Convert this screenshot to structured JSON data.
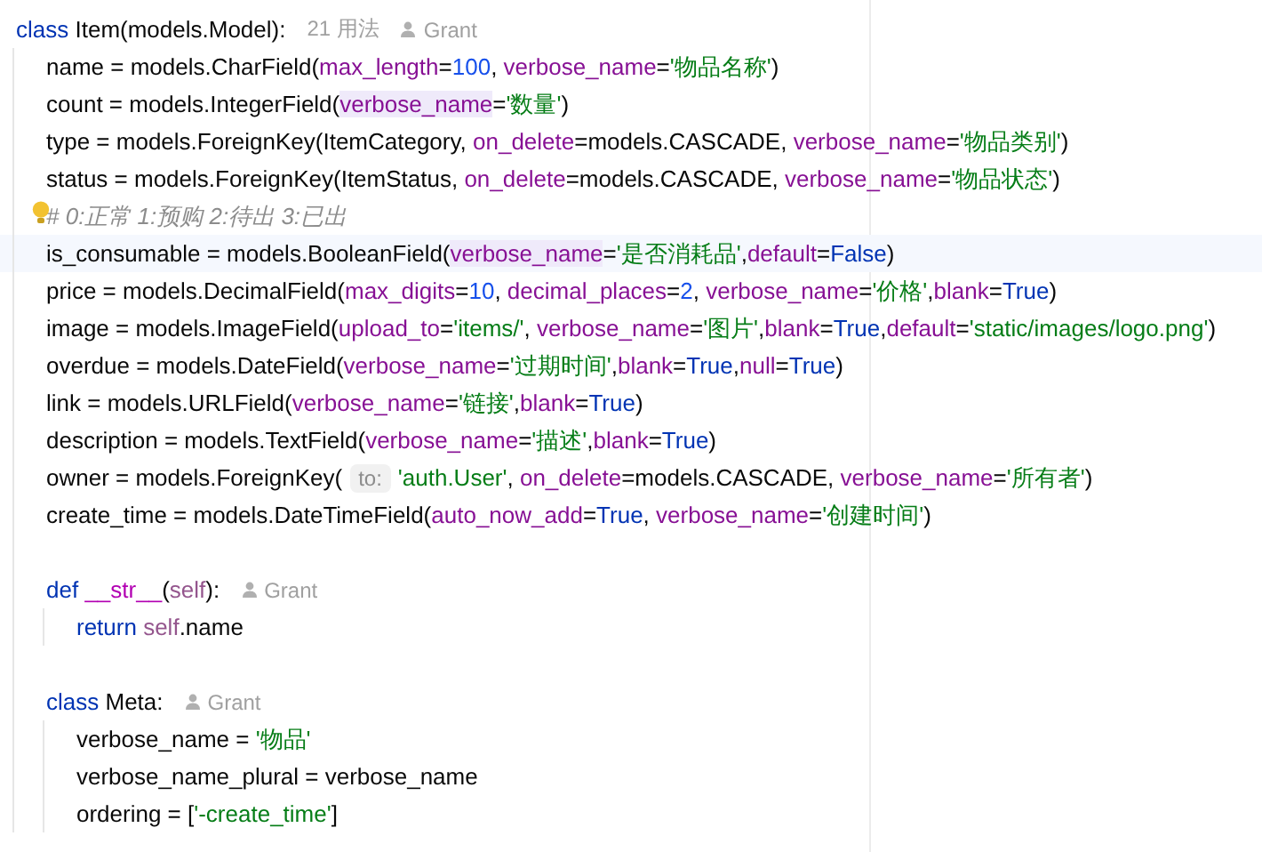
{
  "lines": [
    {
      "kind": "code",
      "tokens": [
        {
          "kind": "kw",
          "t": "class"
        },
        {
          "kind": "plain",
          "t": " Item(models.Model):"
        },
        {
          "kind": "usages",
          "t": "21 用法"
        },
        {
          "kind": "author",
          "t": "Grant"
        }
      ]
    },
    {
      "kind": "code",
      "tokens": [
        {
          "kind": "plain",
          "t": "    name = models.CharField("
        },
        {
          "kind": "param",
          "t": "max_length"
        },
        {
          "kind": "plain",
          "t": "="
        },
        {
          "kind": "num",
          "t": "100"
        },
        {
          "kind": "plain",
          "t": ", "
        },
        {
          "kind": "param",
          "t": "verbose_name"
        },
        {
          "kind": "plain",
          "t": "="
        },
        {
          "kind": "str",
          "t": "'物品名称'"
        },
        {
          "kind": "plain",
          "t": ")"
        }
      ]
    },
    {
      "kind": "code",
      "tokens": [
        {
          "kind": "plain",
          "t": "    count = models.IntegerField("
        },
        {
          "kind": "param-hl",
          "t": "verbose_name"
        },
        {
          "kind": "plain",
          "t": "="
        },
        {
          "kind": "str",
          "t": "'数量'"
        },
        {
          "kind": "plain",
          "t": ")"
        }
      ]
    },
    {
      "kind": "code",
      "tokens": [
        {
          "kind": "plain",
          "t": "    type = models.ForeignKey(ItemCategory, "
        },
        {
          "kind": "param",
          "t": "on_delete"
        },
        {
          "kind": "plain",
          "t": "=models.CASCADE, "
        },
        {
          "kind": "param",
          "t": "verbose_name"
        },
        {
          "kind": "plain",
          "t": "="
        },
        {
          "kind": "str",
          "t": "'物品类别'"
        },
        {
          "kind": "plain",
          "t": ")"
        }
      ]
    },
    {
      "kind": "code",
      "tokens": [
        {
          "kind": "plain",
          "t": "    status = models.ForeignKey(ItemStatus, "
        },
        {
          "kind": "param",
          "t": "on_delete"
        },
        {
          "kind": "plain",
          "t": "=models.CASCADE, "
        },
        {
          "kind": "param",
          "t": "verbose_name"
        },
        {
          "kind": "plain",
          "t": "="
        },
        {
          "kind": "str",
          "t": "'物品状态'"
        },
        {
          "kind": "plain",
          "t": ")"
        }
      ]
    },
    {
      "kind": "code",
      "bulb": true,
      "tokens": [
        {
          "kind": "comment",
          "t": "    # 0:正常 1:预购 2:待出 3:已出"
        }
      ]
    },
    {
      "kind": "code",
      "current": true,
      "tokens": [
        {
          "kind": "plain",
          "t": "    is_consumable = models.BooleanField("
        },
        {
          "kind": "param-hl",
          "t": "verbose_name"
        },
        {
          "kind": "plain",
          "t": "="
        },
        {
          "kind": "str",
          "t": "'是否消耗品'"
        },
        {
          "kind": "plain",
          "t": ","
        },
        {
          "kind": "param",
          "t": "default"
        },
        {
          "kind": "plain",
          "t": "="
        },
        {
          "kind": "const",
          "t": "False"
        },
        {
          "kind": "plain",
          "t": ")"
        }
      ]
    },
    {
      "kind": "code",
      "tokens": [
        {
          "kind": "plain",
          "t": "    price = models.DecimalField("
        },
        {
          "kind": "param",
          "t": "max_digits"
        },
        {
          "kind": "plain",
          "t": "="
        },
        {
          "kind": "num",
          "t": "10"
        },
        {
          "kind": "plain",
          "t": ", "
        },
        {
          "kind": "param",
          "t": "decimal_places"
        },
        {
          "kind": "plain",
          "t": "="
        },
        {
          "kind": "num",
          "t": "2"
        },
        {
          "kind": "plain",
          "t": ", "
        },
        {
          "kind": "param",
          "t": "verbose_name"
        },
        {
          "kind": "plain",
          "t": "="
        },
        {
          "kind": "str",
          "t": "'价格'"
        },
        {
          "kind": "plain",
          "t": ","
        },
        {
          "kind": "param",
          "t": "blank"
        },
        {
          "kind": "plain",
          "t": "="
        },
        {
          "kind": "const",
          "t": "True"
        },
        {
          "kind": "plain",
          "t": ")"
        }
      ]
    },
    {
      "kind": "code",
      "tokens": [
        {
          "kind": "plain",
          "t": "    image = models.ImageField("
        },
        {
          "kind": "param",
          "t": "upload_to"
        },
        {
          "kind": "plain",
          "t": "="
        },
        {
          "kind": "str",
          "t": "'items/'"
        },
        {
          "kind": "plain",
          "t": ", "
        },
        {
          "kind": "param",
          "t": "verbose_name"
        },
        {
          "kind": "plain",
          "t": "="
        },
        {
          "kind": "str",
          "t": "'图片'"
        },
        {
          "kind": "plain",
          "t": ","
        },
        {
          "kind": "param",
          "t": "blank"
        },
        {
          "kind": "plain",
          "t": "="
        },
        {
          "kind": "const",
          "t": "True"
        },
        {
          "kind": "plain",
          "t": ","
        },
        {
          "kind": "param",
          "t": "default"
        },
        {
          "kind": "plain",
          "t": "="
        },
        {
          "kind": "str",
          "t": "'static/images/logo.png'"
        },
        {
          "kind": "plain",
          "t": ")"
        }
      ]
    },
    {
      "kind": "code",
      "tokens": [
        {
          "kind": "plain",
          "t": "    overdue = models.DateField("
        },
        {
          "kind": "param",
          "t": "verbose_name"
        },
        {
          "kind": "plain",
          "t": "="
        },
        {
          "kind": "str",
          "t": "'过期时间'"
        },
        {
          "kind": "plain",
          "t": ","
        },
        {
          "kind": "param",
          "t": "blank"
        },
        {
          "kind": "plain",
          "t": "="
        },
        {
          "kind": "const",
          "t": "True"
        },
        {
          "kind": "plain",
          "t": ","
        },
        {
          "kind": "param",
          "t": "null"
        },
        {
          "kind": "plain",
          "t": "="
        },
        {
          "kind": "const",
          "t": "True"
        },
        {
          "kind": "plain",
          "t": ")"
        }
      ]
    },
    {
      "kind": "code",
      "tokens": [
        {
          "kind": "plain",
          "t": "    link = models.URLField("
        },
        {
          "kind": "param",
          "t": "verbose_name"
        },
        {
          "kind": "plain",
          "t": "="
        },
        {
          "kind": "str",
          "t": "'链接'"
        },
        {
          "kind": "plain",
          "t": ","
        },
        {
          "kind": "param",
          "t": "blank"
        },
        {
          "kind": "plain",
          "t": "="
        },
        {
          "kind": "const",
          "t": "True"
        },
        {
          "kind": "plain",
          "t": ")"
        }
      ]
    },
    {
      "kind": "code",
      "tokens": [
        {
          "kind": "plain",
          "t": "    description = models.TextField("
        },
        {
          "kind": "param",
          "t": "verbose_name"
        },
        {
          "kind": "plain",
          "t": "="
        },
        {
          "kind": "str",
          "t": "'描述'"
        },
        {
          "kind": "plain",
          "t": ","
        },
        {
          "kind": "param",
          "t": "blank"
        },
        {
          "kind": "plain",
          "t": "="
        },
        {
          "kind": "const",
          "t": "True"
        },
        {
          "kind": "plain",
          "t": ")"
        }
      ]
    },
    {
      "kind": "code",
      "tokens": [
        {
          "kind": "plain",
          "t": "    owner = models.ForeignKey("
        },
        {
          "kind": "hint",
          "t": "to:"
        },
        {
          "kind": "str",
          "t": "'auth.User'"
        },
        {
          "kind": "plain",
          "t": ", "
        },
        {
          "kind": "param",
          "t": "on_delete"
        },
        {
          "kind": "plain",
          "t": "=models.CASCADE, "
        },
        {
          "kind": "param",
          "t": "verbose_name"
        },
        {
          "kind": "plain",
          "t": "="
        },
        {
          "kind": "str",
          "t": "'所有者'"
        },
        {
          "kind": "plain",
          "t": ")"
        }
      ]
    },
    {
      "kind": "code",
      "tokens": [
        {
          "kind": "plain",
          "t": "    create_time = models.DateTimeField("
        },
        {
          "kind": "param",
          "t": "auto_now_add"
        },
        {
          "kind": "plain",
          "t": "="
        },
        {
          "kind": "const",
          "t": "True"
        },
        {
          "kind": "plain",
          "t": ", "
        },
        {
          "kind": "param",
          "t": "verbose_name"
        },
        {
          "kind": "plain",
          "t": "="
        },
        {
          "kind": "str",
          "t": "'创建时间'"
        },
        {
          "kind": "plain",
          "t": ")"
        }
      ]
    },
    {
      "kind": "blank"
    },
    {
      "kind": "code",
      "tokens": [
        {
          "kind": "kw",
          "t": "    def "
        },
        {
          "kind": "dunder",
          "t": "__str__"
        },
        {
          "kind": "plain",
          "t": "("
        },
        {
          "kind": "self",
          "t": "self"
        },
        {
          "kind": "plain",
          "t": "):"
        },
        {
          "kind": "author",
          "t": "Grant"
        }
      ]
    },
    {
      "kind": "code",
      "tokens": [
        {
          "kind": "kw",
          "t": "        return "
        },
        {
          "kind": "self",
          "t": "self"
        },
        {
          "kind": "plain",
          "t": ".name"
        }
      ]
    },
    {
      "kind": "blank"
    },
    {
      "kind": "code",
      "tokens": [
        {
          "kind": "kw",
          "t": "    class"
        },
        {
          "kind": "plain",
          "t": " Meta:"
        },
        {
          "kind": "author",
          "t": "Grant"
        }
      ]
    },
    {
      "kind": "code",
      "tokens": [
        {
          "kind": "plain",
          "t": "        verbose_name = "
        },
        {
          "kind": "str",
          "t": "'物品'"
        }
      ]
    },
    {
      "kind": "code",
      "tokens": [
        {
          "kind": "plain",
          "t": "        verbose_name_plural = verbose_name"
        }
      ]
    },
    {
      "kind": "code",
      "tokens": [
        {
          "kind": "plain",
          "t": "        ordering = ["
        },
        {
          "kind": "str",
          "t": "'-create_time'"
        },
        {
          "kind": "plain",
          "t": "]"
        }
      ]
    }
  ]
}
